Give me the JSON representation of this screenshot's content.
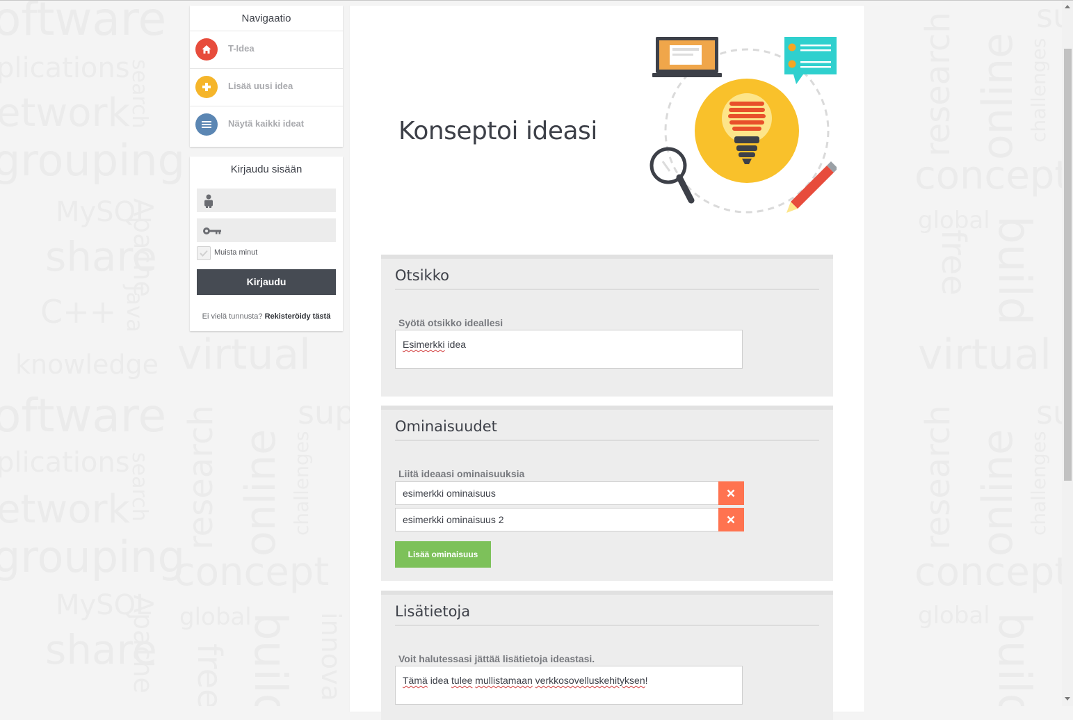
{
  "nav": {
    "title": "Navigaatio",
    "items": [
      {
        "label": "T-Idea",
        "icon": "home-icon",
        "color": "#e74c3c"
      },
      {
        "label": "Lisää uusi idea",
        "icon": "plus-icon",
        "color": "#f5b52a"
      },
      {
        "label": "Näytä kaikki ideat",
        "icon": "list-icon",
        "color": "#5b86b3"
      }
    ]
  },
  "login": {
    "title": "Kirjaudu sisään",
    "username_placeholder": "",
    "password_placeholder": "",
    "remember_label": "Muista minut",
    "button_label": "Kirjaudu",
    "register_prompt": "Ei vielä tunnusta?",
    "register_link": "Rekisteröidy tästä"
  },
  "main": {
    "heading": "Konseptoi ideasi",
    "sections": {
      "title": {
        "heading": "Otsikko",
        "hint": "Syötä otsikko ideallesi",
        "value_word1": "Esimerkki",
        "value_word2": "idea"
      },
      "features": {
        "heading": "Ominaisuudet",
        "hint": "Liitä ideaasi ominaisuuksia",
        "items": [
          "esimerkki ominaisuus",
          "esimerkki ominaisuus 2"
        ],
        "add_label": "Lisää ominaisuus"
      },
      "extra": {
        "heading": "Lisätietoja",
        "hint": "Voit halutessasi jättää lisätietoja ideastasi.",
        "value_w1": "Tämä",
        "value_w2": "idea",
        "value_w3": "tulee",
        "value_w4": "mullistamaan",
        "value_w5": "verkkosovelluskehityksen",
        "value_w6": "!"
      }
    }
  },
  "colors": {
    "accent_dark": "#464b53",
    "delete": "#ff7350",
    "add": "#7dc15a",
    "bulb": "#f9c12b",
    "teal": "#2fd0ce"
  }
}
